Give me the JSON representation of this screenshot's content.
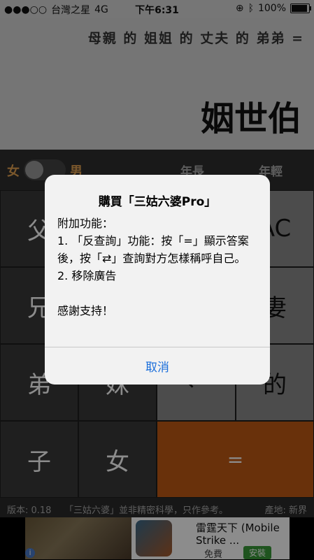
{
  "status_bar": {
    "carrier": "台灣之星",
    "network": "4G",
    "time": "下午6:31",
    "battery": "100%"
  },
  "display": {
    "expression": "母親 的 姐姐 的 丈夫 的 弟弟 =",
    "result": "姻世伯"
  },
  "controls": {
    "female_label": "女",
    "male_label": "男",
    "older_label": "年長",
    "younger_label": "年輕"
  },
  "keypad": {
    "keys": [
      "父",
      "AC",
      "兄",
      "妻",
      "弟",
      "妹",
      "←",
      "的",
      "子",
      "女",
      "="
    ]
  },
  "footer": {
    "version": "版本: 0.18",
    "disclaimer": "「三姑六婆」並非精密科學，只作參考。",
    "origin": "產地: 新界"
  },
  "ad": {
    "title": "雷霆天下 (Mobile Strike ...",
    "price": "免費",
    "install": "安裝"
  },
  "dialog": {
    "title": "購買「三姑六婆Pro」",
    "line1": "附加功能：",
    "line2": "1. 「反查詢」功能：按「=」顯示答案後，按「⇄」查詢對方怎樣稱呼自己。",
    "line3": "2. 移除廣告",
    "line4": "感謝支持！",
    "cancel": "取消"
  }
}
